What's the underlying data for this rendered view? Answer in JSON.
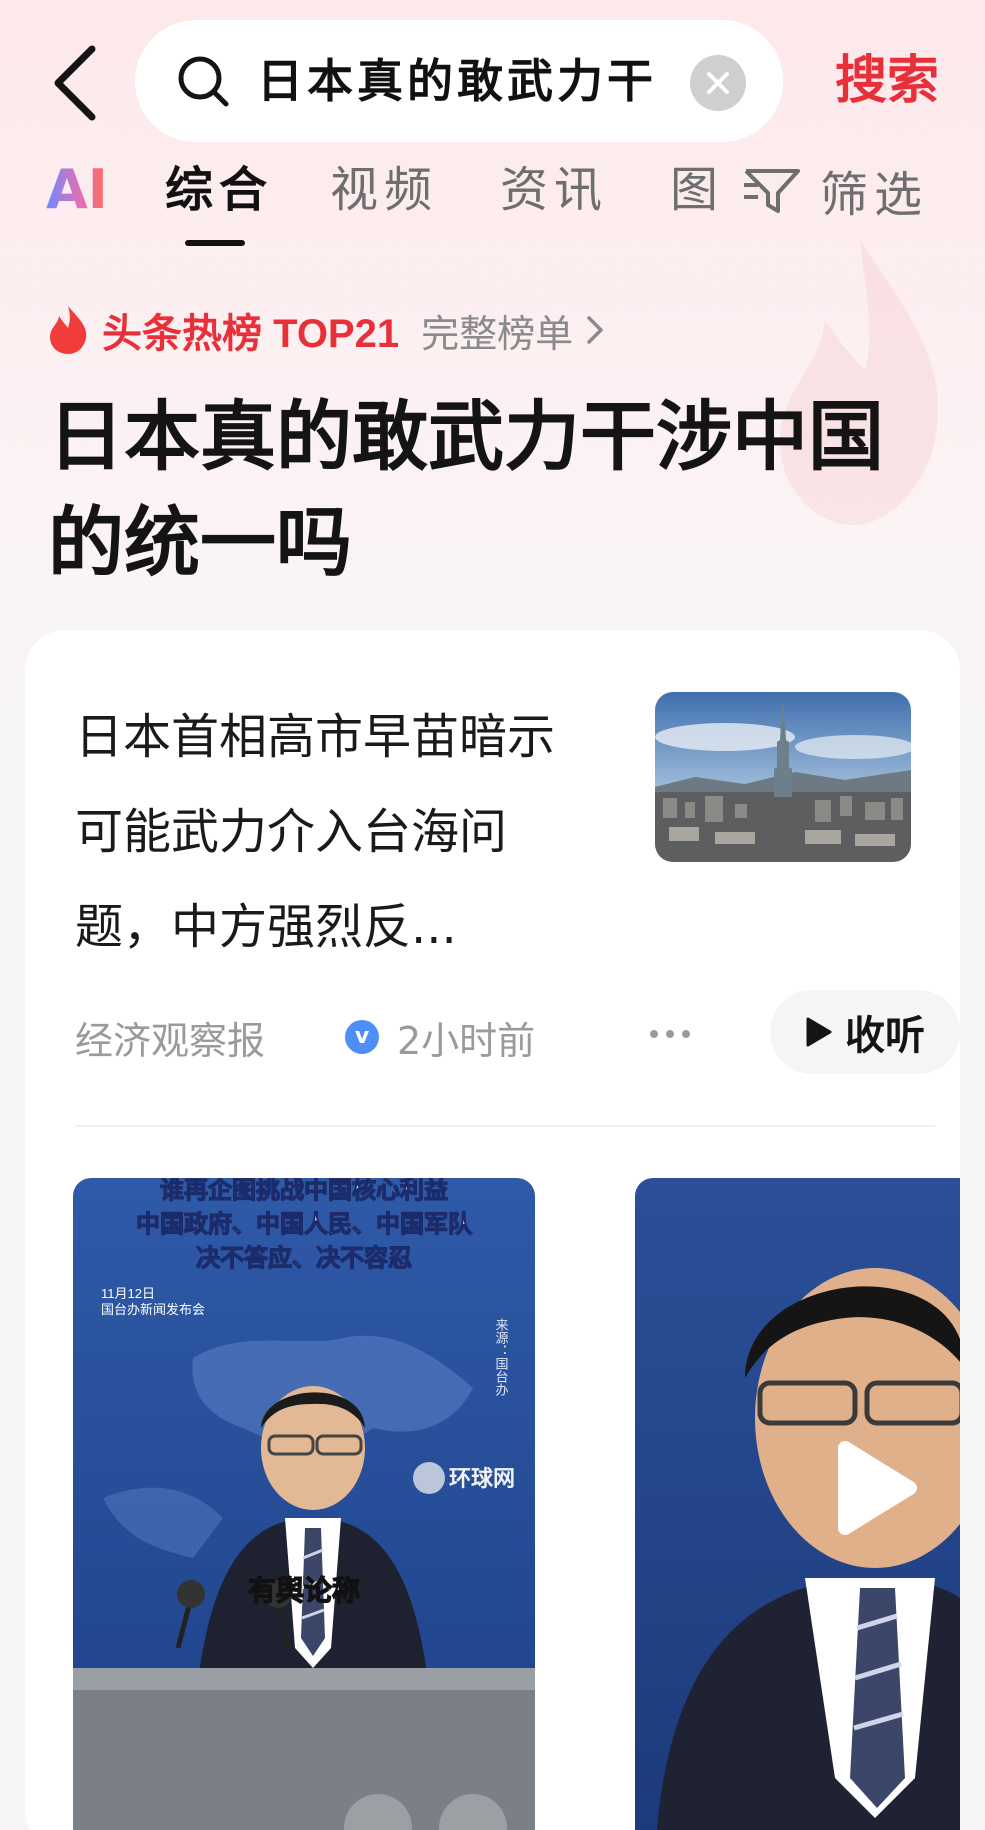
{
  "search": {
    "query": "日本真的敢武力干",
    "submit_label": "搜索"
  },
  "tabs": [
    {
      "label": "AI"
    },
    {
      "label": "综合",
      "active": true
    },
    {
      "label": "视频"
    },
    {
      "label": "资讯"
    },
    {
      "label": "图"
    }
  ],
  "filter": {
    "label": "筛选"
  },
  "hot": {
    "label": "头条热榜 TOP21",
    "full_list_label": "完整榜单",
    "topic_title": "日本真的敢武力干涉中国的统一吗"
  },
  "article": {
    "title": "日本首相高市早苗暗示可能武力介入台海问题，中方强烈反...",
    "source": "经济观察报",
    "verified_badge": "v",
    "time": "2小时前",
    "listen_label": "收听"
  },
  "video_1": {
    "caption_lines": [
      "谁再企图挑战中国核心利益",
      "中国政府、中国人民、中国军队",
      "决不答应、决不容忍"
    ],
    "date_line_1": "11月12日",
    "date_line_2": "国台办新闻发布会",
    "source_note": "来源：国台办",
    "watermark": "环球网",
    "subtitle": "有舆论称"
  },
  "colors": {
    "accent_red": "#e8303a",
    "verified_blue": "#4f8ef7",
    "page_bg_top": "#fde8ea"
  },
  "icons": {
    "back": "chevron-left-icon",
    "search": "search-icon",
    "clear": "close-icon",
    "filter": "filter-icon",
    "hot": "flame-icon",
    "listen": "play-icon",
    "video_play": "play-icon"
  }
}
